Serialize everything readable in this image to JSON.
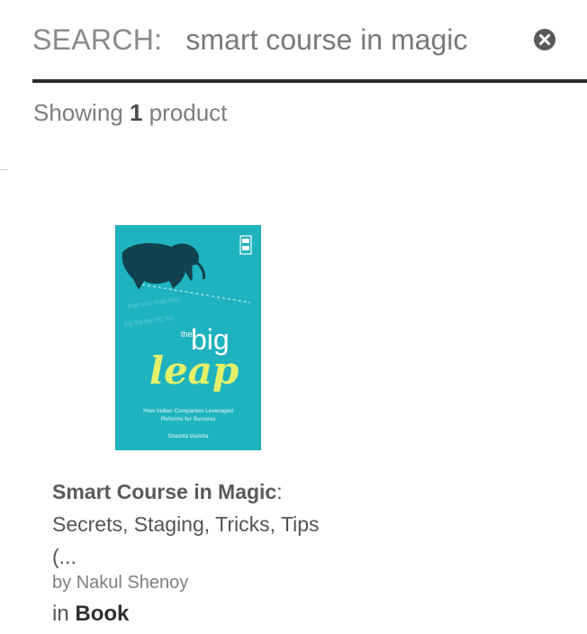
{
  "search": {
    "label": "SEARCH:",
    "query": "smart course in magic",
    "clear_icon": "close-circle-icon"
  },
  "results": {
    "prefix": "Showing",
    "count": "1",
    "suffix": "product"
  },
  "product": {
    "title_bold": "Smart Course in Magic",
    "title_colon": ":",
    "title_rest": "Secrets, Staging, Tricks, Tips (...",
    "by_prefix": "by",
    "author": "Nakul Shenoy",
    "in_prefix": "in",
    "category": "Book",
    "cover": {
      "the": "the",
      "big": "big",
      "leap": "leap",
      "subtitle_line1": "How Indian Companies Leveraged",
      "subtitle_line2": "Reforms for Success",
      "author": "Shaunta Vasisha",
      "bg_color": "#1fb3bf"
    }
  },
  "colors": {
    "rule": "#2b2b2b",
    "text": "#555555",
    "muted": "#7e7e7e"
  }
}
